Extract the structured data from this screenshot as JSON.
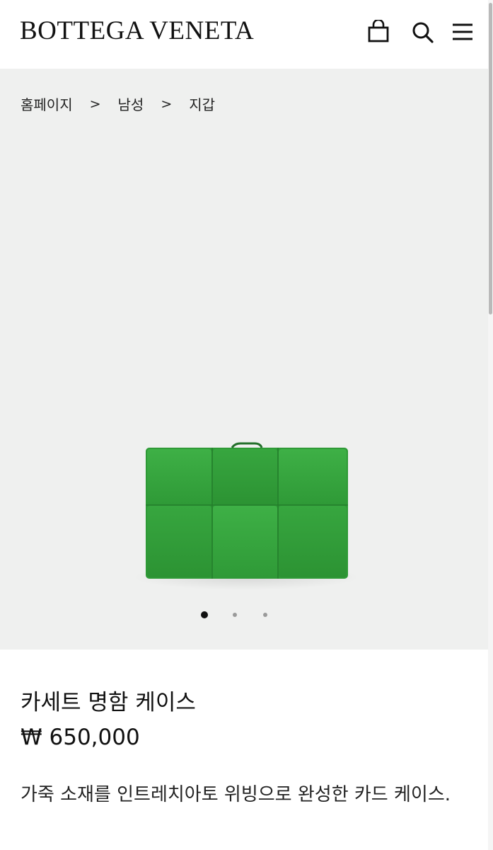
{
  "header": {
    "logo": "BOTTEGA VENETA",
    "icons": [
      "shopping-bag-icon",
      "search-icon",
      "menu-icon"
    ]
  },
  "breadcrumb": {
    "items": [
      "홈페이지",
      "남성",
      "지갑"
    ],
    "separator": ">"
  },
  "gallery": {
    "image_count": 3,
    "active_index": 0,
    "background": "#eff0ef",
    "product_color": "#32a13b"
  },
  "product": {
    "name": "카세트 명함 케이스",
    "price": "₩ 650,000",
    "description": "가죽 소재를 인트레치아토 위빙으로 완성한 카드 케이스."
  }
}
